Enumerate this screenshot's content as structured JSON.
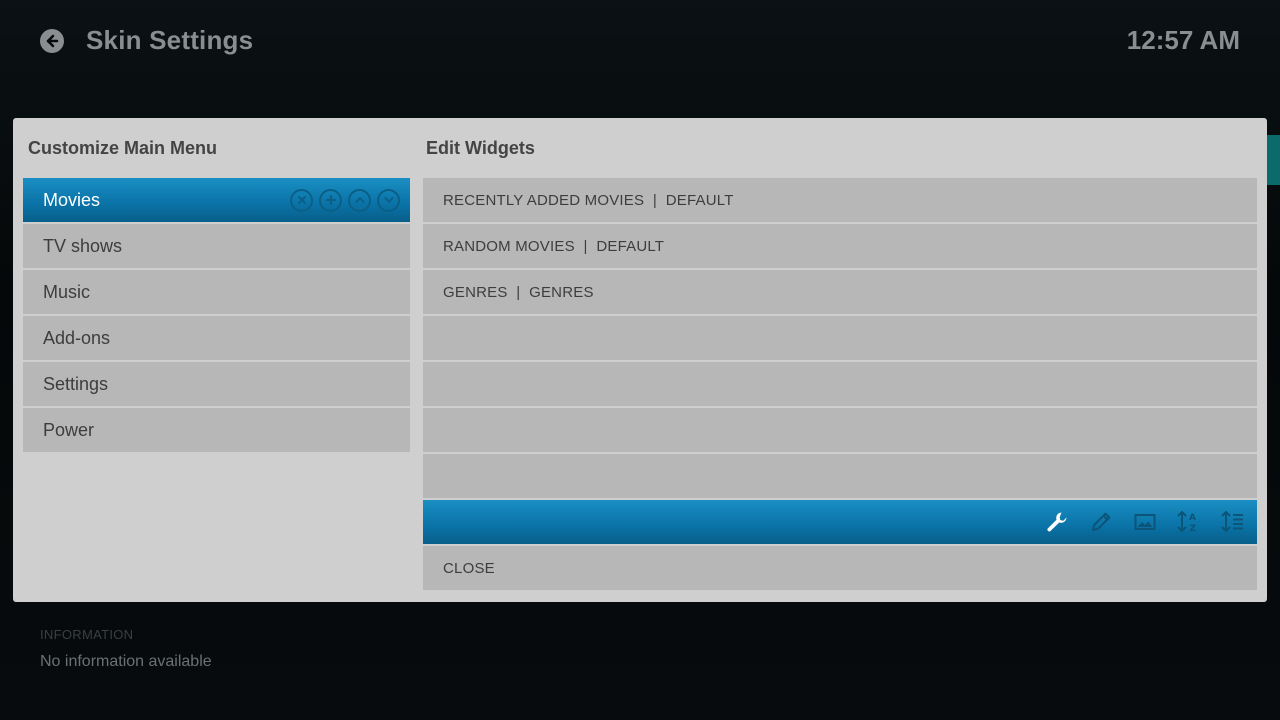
{
  "header": {
    "title": "Skin Settings",
    "clock": "12:57 AM",
    "back_icon": "back-arrow-icon"
  },
  "info": {
    "label": "INFORMATION",
    "value": "No information available"
  },
  "dialog": {
    "left_title": "Customize Main Menu",
    "right_title": "Edit Widgets",
    "menu_items": [
      {
        "label": "Movies",
        "active": true
      },
      {
        "label": "TV shows",
        "active": false
      },
      {
        "label": "Music",
        "active": false
      },
      {
        "label": "Add-ons",
        "active": false
      },
      {
        "label": "Settings",
        "active": false
      },
      {
        "label": "Power",
        "active": false
      }
    ],
    "menu_controls": [
      "remove-icon",
      "add-icon",
      "move-up-icon",
      "move-down-icon"
    ],
    "widgets": [
      {
        "label": "RECENTLY ADDED MOVIES  |  DEFAULT"
      },
      {
        "label": "RANDOM MOVIES  |  DEFAULT"
      },
      {
        "label": "GENRES  |  GENRES"
      },
      {
        "label": ""
      },
      {
        "label": ""
      },
      {
        "label": ""
      },
      {
        "label": ""
      },
      {
        "label": ""
      },
      {
        "label": "CLOSE"
      }
    ],
    "widget_tools": [
      "wrench-icon",
      "pencil-icon",
      "image-icon",
      "sort-alpha-icon",
      "sort-list-icon"
    ]
  },
  "colors": {
    "accent": "#0a72a6",
    "panel": "#cfcfcf",
    "item": "#b7b7b7",
    "header_text": "#8a8e90"
  }
}
